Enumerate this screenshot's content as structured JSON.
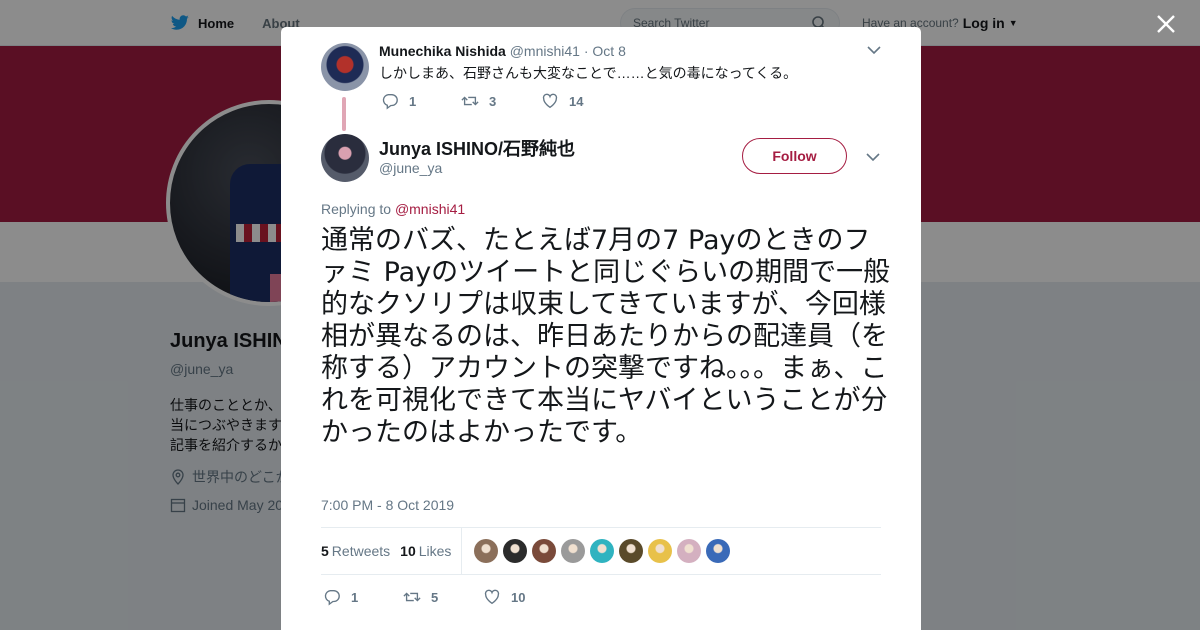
{
  "topnav": {
    "home_label": "Home",
    "about_label": "About",
    "search_placeholder": "Search Twitter",
    "account_prompt": "Have an account?",
    "login_label": "Log in"
  },
  "profile": {
    "name": "Junya ISHIN",
    "handle": "@june_ya",
    "bio": "仕事のこととか、当につぶやきます記事を紹介するか",
    "location": "世界中のどこか",
    "joined": "Joined May 20"
  },
  "parent_tweet": {
    "name": "Munechika Nishida",
    "handle": "@mnishi41",
    "date": "· Oct 8",
    "text": "しかしまあ、石野さんも大変なことで……と気の毒になってくる。",
    "replies": "1",
    "retweets": "3",
    "likes": "14"
  },
  "tweet": {
    "author_name": "Junya ISHINO/石野純也",
    "author_handle": "@june_ya",
    "follow_label": "Follow",
    "replying_prefix": "Replying to",
    "replying_to": "@mnishi41",
    "text": "通常のバズ、たとえば7月の7 Payのときのファミ Payのツイートと同じぐらいの期間で一般的なクソリプは収束してきていますが、今回様相が異なるのは、昨日あたりからの配達員（を称する）アカウントの突撃ですね。。。まぁ、これを可視化できて本当にヤバイということが分かったのはよかったです。",
    "timestamp": "7:00 PM - 8 Oct 2019",
    "retweets_count": "5",
    "retweets_label": "Retweets",
    "likes_count": "10",
    "likes_label": "Likes",
    "replies": "1",
    "retweets": "5",
    "likes": "10"
  },
  "colors": {
    "accent": "#a51d42",
    "banner": "#a51d42",
    "liker_avatars": [
      "#8b6f5a",
      "#2b2b2b",
      "#7a4a3a",
      "#9a9a9a",
      "#2fb3c0",
      "#5a4a2a",
      "#e8c14a",
      "#d4b0c0",
      "#3a6ab8"
    ]
  }
}
